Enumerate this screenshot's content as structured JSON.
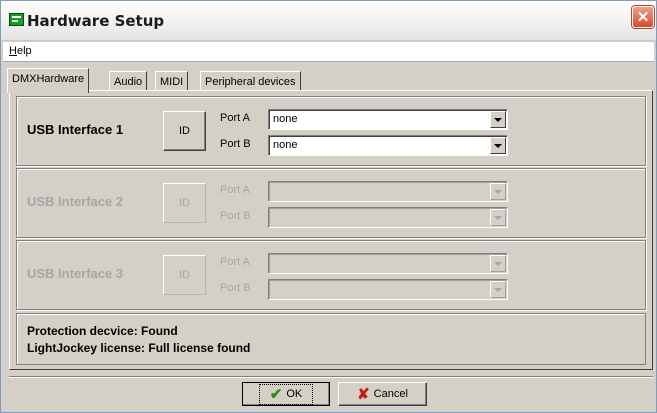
{
  "window": {
    "title": "Hardware Setup"
  },
  "menu": {
    "help_prefix": "",
    "help_underlined": "H",
    "help_rest": "elp"
  },
  "tabs": [
    {
      "label": "DMXHardware",
      "active": true
    },
    {
      "label": "Audio",
      "active": false
    },
    {
      "label": "MIDI",
      "active": false
    },
    {
      "label": "Peripheral devices",
      "active": false
    }
  ],
  "interfaces": [
    {
      "label": "USB Interface 1",
      "id_label": "ID",
      "port_a_label": "Port A",
      "port_b_label": "Port B",
      "port_a_value": "none",
      "port_b_value": "none",
      "enabled": true
    },
    {
      "label": "USB Interface 2",
      "id_label": "ID",
      "port_a_label": "Port A",
      "port_b_label": "Port B",
      "port_a_value": "",
      "port_b_value": "",
      "enabled": false
    },
    {
      "label": "USB Interface 3",
      "id_label": "ID",
      "port_a_label": "Port A",
      "port_b_label": "Port B",
      "port_a_value": "",
      "port_b_value": "",
      "enabled": false
    }
  ],
  "info": {
    "protection": "Protection decvice: Found",
    "license": "LightJockey license: Full license found"
  },
  "buttons": {
    "ok_label": "OK",
    "cancel_label": "Cancel"
  },
  "icons": {
    "app": "app-icon",
    "close": "close-icon",
    "ok": "check-icon",
    "cancel": "cross-icon"
  },
  "colors": {
    "ok_check": "#1e8f1e",
    "cancel_cross": "#cc1a10",
    "close_button": "#d64a2e"
  }
}
